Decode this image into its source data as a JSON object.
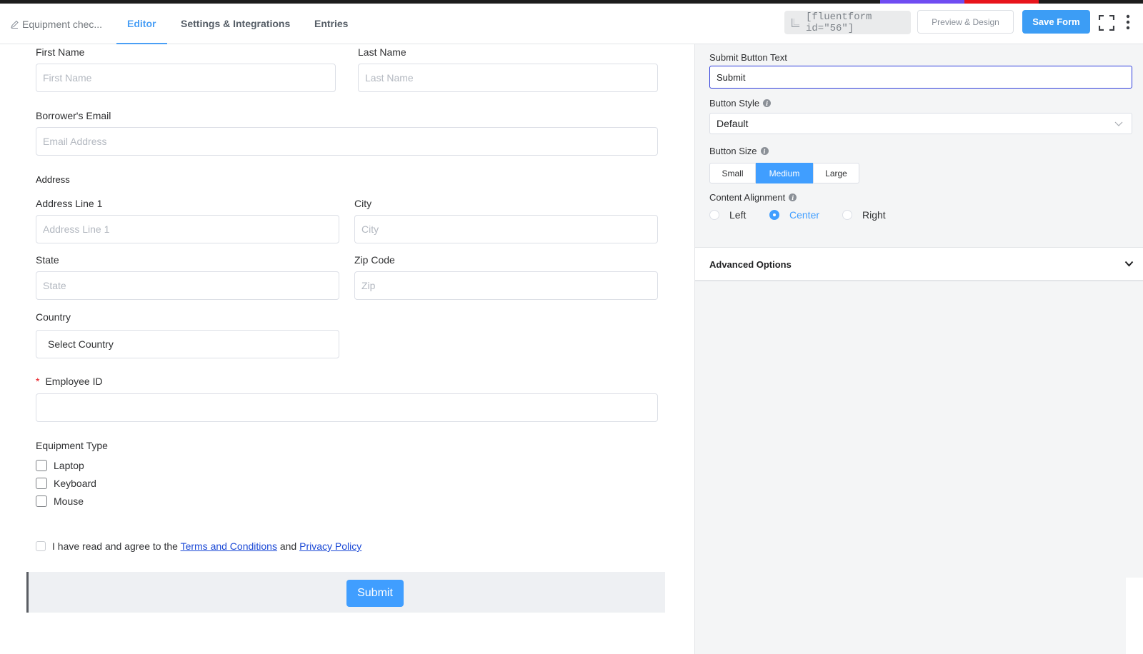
{
  "topbar": {
    "breadcrumb": "Equipment chec...",
    "tabs": [
      {
        "label": "Editor",
        "active": true
      },
      {
        "label": "Settings & Integrations",
        "active": false
      },
      {
        "label": "Entries",
        "active": false
      }
    ],
    "shortcode": "[fluentform id=\"56\"]",
    "preview_label": "Preview & Design",
    "save_label": "Save Form"
  },
  "form": {
    "first_name_label": "First Name",
    "first_name_placeholder": "First Name",
    "last_name_label": "Last Name",
    "last_name_placeholder": "Last Name",
    "email_label": "Borrower's Email",
    "email_placeholder": "Email Address",
    "address_title": "Address",
    "address1_label": "Address Line 1",
    "address1_placeholder": "Address Line 1",
    "city_label": "City",
    "city_placeholder": "City",
    "state_label": "State",
    "state_placeholder": "State",
    "zip_label": "Zip Code",
    "zip_placeholder": "Zip",
    "country_label": "Country",
    "country_value": "Select Country",
    "employee_id_required": "*",
    "employee_id_label": "Employee ID",
    "equipment_label": "Equipment Type",
    "equipment_options": [
      "Laptop",
      "Keyboard",
      "Mouse"
    ],
    "terms_prefix": "I have read and agree to the",
    "terms_link": "Terms and Conditions",
    "terms_and": "and",
    "privacy_link": "Privacy Policy",
    "submit_label": "Submit"
  },
  "settings": {
    "submit_text_label": "Submit Button Text",
    "submit_text_value": "Submit",
    "button_style_label": "Button Style",
    "button_style_value": "Default",
    "button_size_label": "Button Size",
    "button_sizes": [
      {
        "label": "Small",
        "selected": false
      },
      {
        "label": "Medium",
        "selected": true
      },
      {
        "label": "Large",
        "selected": false
      }
    ],
    "content_alignment_label": "Content Alignment",
    "alignments": [
      {
        "label": "Left",
        "selected": false
      },
      {
        "label": "Center",
        "selected": true
      },
      {
        "label": "Right",
        "selected": false
      }
    ],
    "advanced_label": "Advanced Options"
  },
  "colors": {
    "accent": "#409eff",
    "tab_active": "#4a9ff5",
    "required": "#e8141b",
    "link": "#1b49d6"
  }
}
